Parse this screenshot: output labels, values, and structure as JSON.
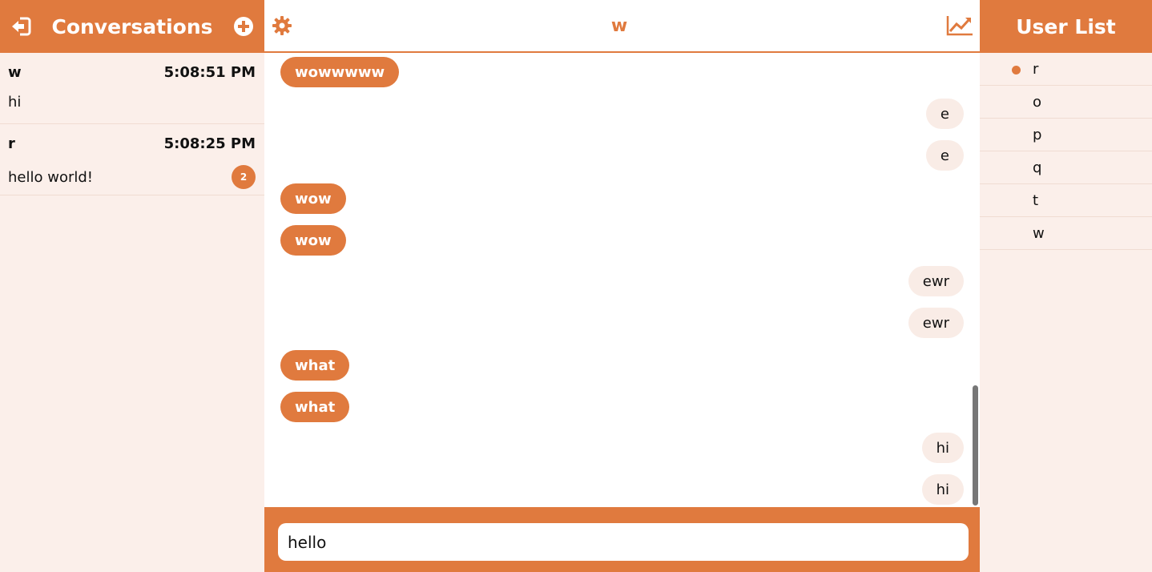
{
  "conversations_panel": {
    "title": "Conversations",
    "items": [
      {
        "name": "w",
        "time": "5:08:51 PM",
        "preview": "hi",
        "unread": ""
      },
      {
        "name": "r",
        "time": "5:08:25 PM",
        "preview": "hello world!",
        "unread": "2"
      }
    ]
  },
  "chat": {
    "title": "w",
    "messages": [
      {
        "text": "wowwwww",
        "dir": "in"
      },
      {
        "text": "e",
        "dir": "out"
      },
      {
        "text": "e",
        "dir": "out"
      },
      {
        "text": "wow",
        "dir": "in"
      },
      {
        "text": "wow",
        "dir": "in"
      },
      {
        "text": "ewr",
        "dir": "out"
      },
      {
        "text": "ewr",
        "dir": "out"
      },
      {
        "text": "what",
        "dir": "in"
      },
      {
        "text": "what",
        "dir": "in"
      },
      {
        "text": "hi",
        "dir": "out"
      },
      {
        "text": "hi",
        "dir": "out"
      }
    ],
    "input_value": "hello"
  },
  "user_list": {
    "title": "User List",
    "users": [
      {
        "name": "r",
        "online": true
      },
      {
        "name": "o",
        "online": false
      },
      {
        "name": "p",
        "online": false
      },
      {
        "name": "q",
        "online": false
      },
      {
        "name": "t",
        "online": false
      },
      {
        "name": "w",
        "online": false
      }
    ]
  },
  "icons": {
    "logout": "sign-out-icon",
    "new_conversation": "plus-circle-icon",
    "settings": "gear-icon",
    "stats": "line-chart-icon"
  },
  "colors": {
    "accent": "#e07a3e",
    "panel_bg": "#fbefea",
    "outgoing_bubble": "#f9ece6"
  }
}
